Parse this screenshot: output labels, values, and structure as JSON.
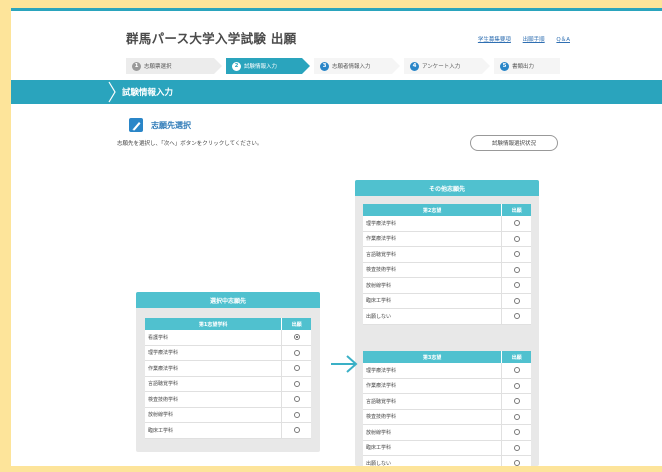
{
  "header": {
    "title": "群馬パース大学入学試験 出願",
    "links": [
      "学生募集要項",
      "出願手順",
      "Q＆A"
    ]
  },
  "steps": [
    {
      "num": "1",
      "label": "志願票選択"
    },
    {
      "num": "2",
      "label": "試験情報入力"
    },
    {
      "num": "3",
      "label": "志願者情報入力"
    },
    {
      "num": "4",
      "label": "アンケート入力"
    },
    {
      "num": "5",
      "label": "書類出力"
    }
  ],
  "banner": {
    "title": "試験情報入力"
  },
  "section": {
    "title": "志願先選択",
    "instruction": "志願先を選択し、「次へ」ボタンをクリックしてください。",
    "status_button": "試験情報選択状況"
  },
  "selected_panel": {
    "title": "選択中志願先",
    "table": {
      "col_name": "第1志望学科",
      "col_apply": "出願",
      "rows": [
        {
          "name": "看護学科",
          "checked": true
        },
        {
          "name": "理学療法学科",
          "checked": false
        },
        {
          "name": "作業療法学科",
          "checked": false
        },
        {
          "name": "言語聴覚学科",
          "checked": false
        },
        {
          "name": "検査技術学科",
          "checked": false
        },
        {
          "name": "放射線学科",
          "checked": false
        },
        {
          "name": "臨床工学科",
          "checked": false
        }
      ]
    }
  },
  "other_panel": {
    "title": "その他志願先",
    "tables": [
      {
        "col_name": "第2志望",
        "col_apply": "出願",
        "rows": [
          "理学療法学科",
          "作業療法学科",
          "言語聴覚学科",
          "検査技術学科",
          "放射線学科",
          "臨床工学科",
          "出願しない"
        ]
      },
      {
        "col_name": "第3志望",
        "col_apply": "出願",
        "rows": [
          "理学療法学科",
          "作業療法学科",
          "言語聴覚学科",
          "検査技術学科",
          "放射線学科",
          "臨床工学科",
          "出願しない"
        ]
      }
    ]
  },
  "colors": {
    "accent": "#2aa4bd",
    "panel_head": "#50c1cf",
    "link": "#2f6fb2",
    "background": "#fde49a"
  }
}
